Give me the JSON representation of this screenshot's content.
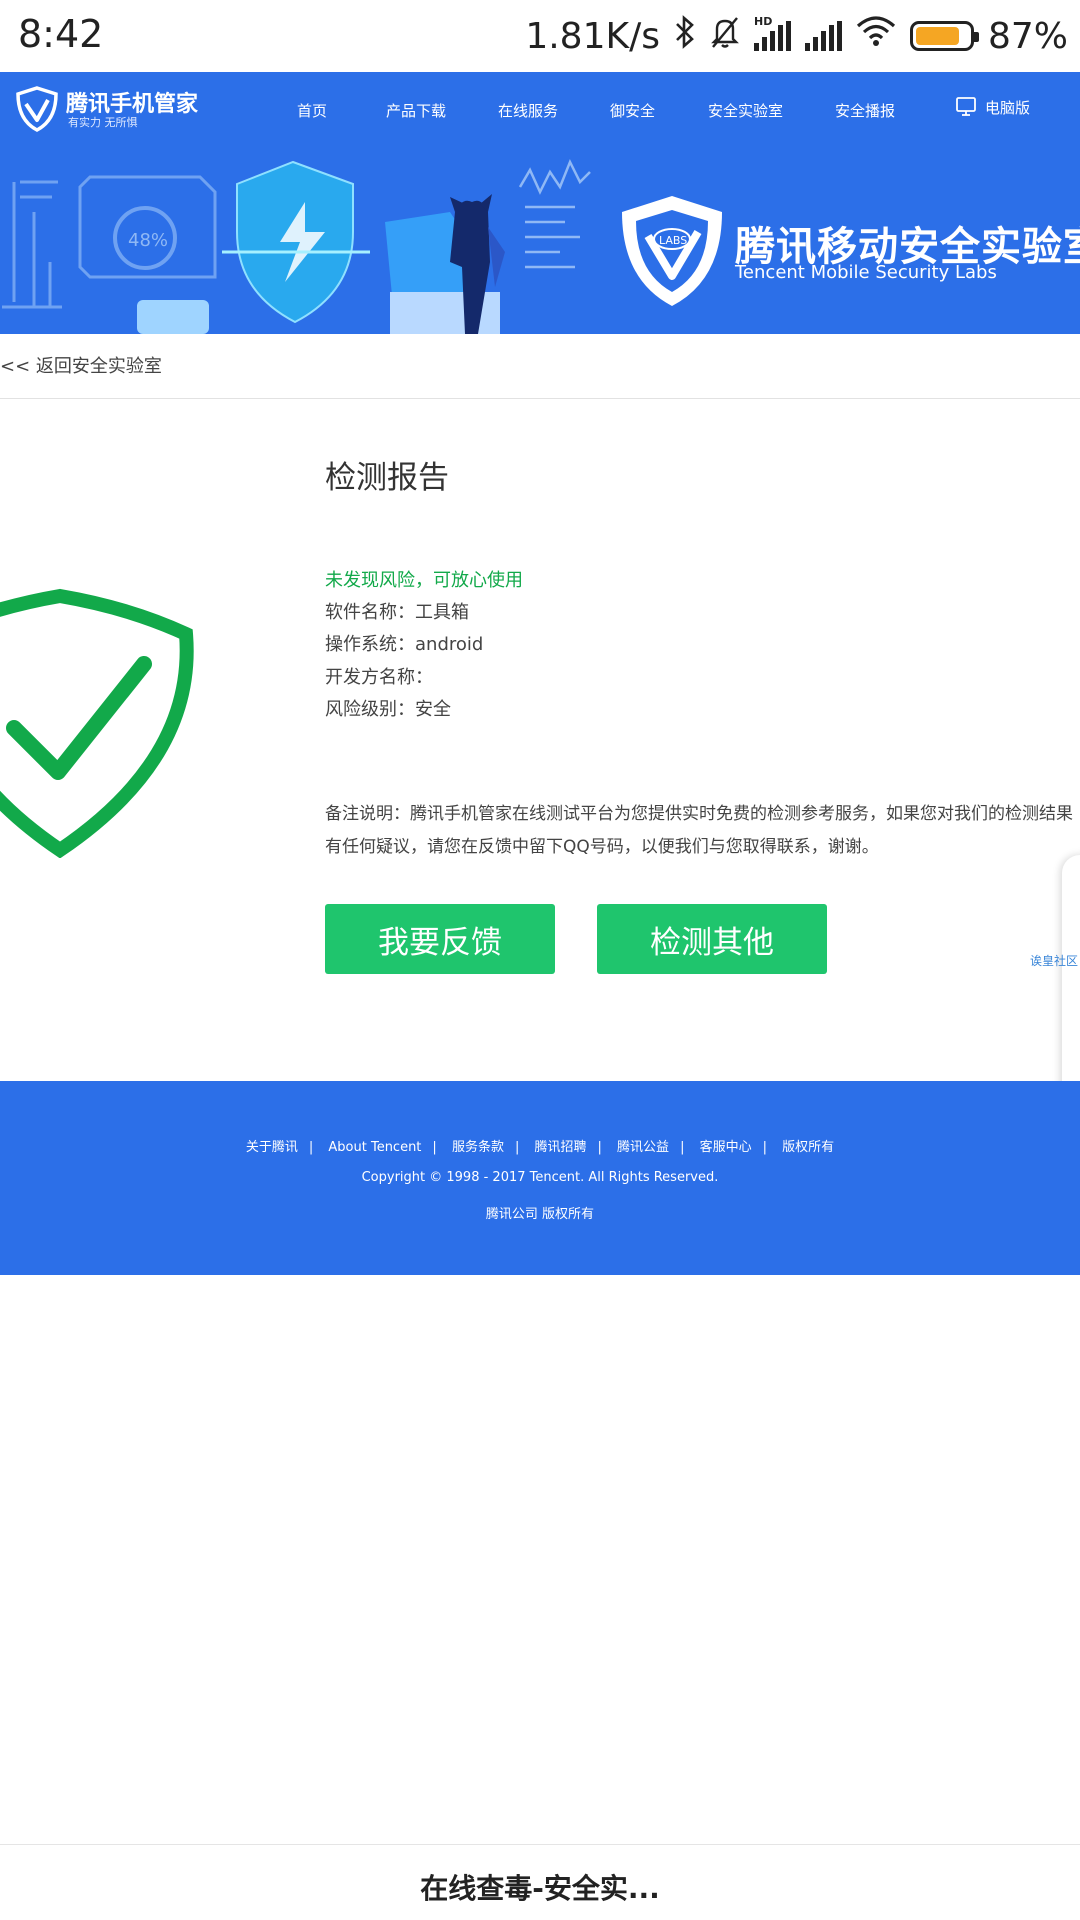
{
  "status_bar": {
    "time": "8:42",
    "net_speed": "1.81K/s",
    "battery": "87%",
    "icons": [
      "bluetooth-icon",
      "mute-bell-icon",
      "hd-signal-icon",
      "signal-icon",
      "wifi-icon",
      "battery-icon"
    ]
  },
  "nav": {
    "brand": "腾讯手机管家",
    "slogan": "有实力 无所惧",
    "items": [
      "首页",
      "产品下载",
      "在线服务",
      "御安全",
      "安全实验室",
      "安全播报"
    ],
    "pc_label": "电脑版"
  },
  "banner": {
    "title": "腾讯移动安全实验室",
    "subtitle": "Tencent Mobile Security Labs",
    "badge": "LABS",
    "gauge_text": "48%"
  },
  "back_link": "<< 返回安全实验室",
  "report": {
    "title": "检测报告",
    "status": "未发现风险，可放心使用",
    "software_name": "软件名称：工具箱",
    "os": "操作系统：android",
    "developer": "开发方名称：",
    "risk_level": "风险级别：安全",
    "note": "备注说明：腾讯手机管家在线测试平台为您提供实时免费的检测参考服务，如果您对我们的检测结果有任何疑议，请您在反馈中留下QQ号码，以便我们与您取得联系，谢谢。",
    "feedback_button": "我要反馈",
    "check_other_button": "检测其他"
  },
  "side_panel": {
    "text": "诶皇社区"
  },
  "footer": {
    "links": [
      "关于腾讯",
      "About Tencent",
      "服务条款",
      "腾讯招聘",
      "腾讯公益",
      "客服中心",
      "版权所有"
    ],
    "copyright": "Copyright © 1998 - 2017 Tencent. All Rights Reserved.",
    "rights": "腾讯公司 版权所有"
  },
  "bottom_bar": {
    "title": "在线查毒-安全实..."
  },
  "colors": {
    "brand_blue": "#2c6fe8",
    "safe_green": "#12a94a",
    "button_green": "#1fc56d"
  }
}
